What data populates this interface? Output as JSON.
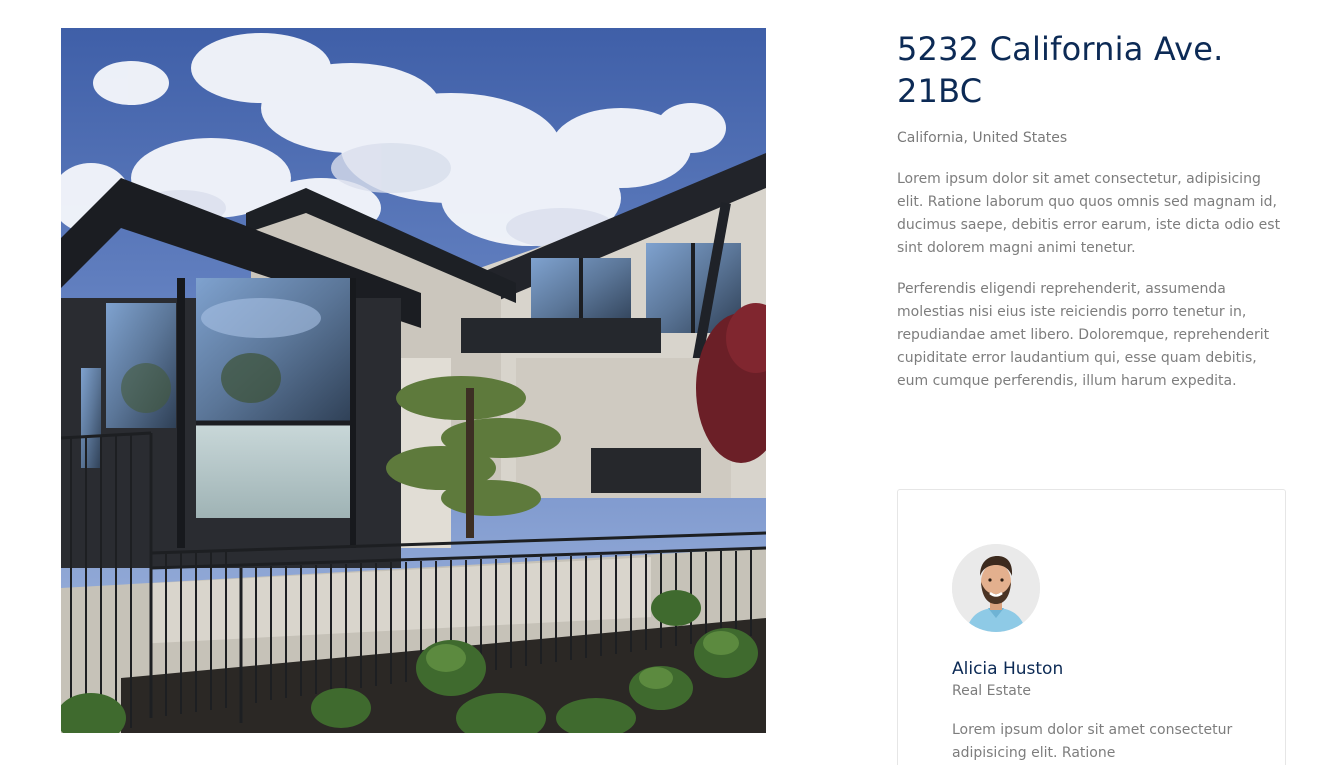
{
  "property": {
    "title": "5232 California Ave. 21BC",
    "location": "California, United States",
    "description": [
      "Lorem ipsum dolor sit amet consectetur, adipisicing elit. Ratione laborum quo quos omnis sed magnam id, ducimus saepe, debitis error earum, iste dicta odio est sint dolorem magni animi tenetur.",
      "Perferendis eligendi reprehenderit, assumenda molestias nisi eius iste reiciendis porro tenetur in, repudiandae amet libero. Doloremque, reprehenderit cupiditate error laudantium qui, esse quam debitis, eum cumque perferendis, illum harum expedita."
    ],
    "photo_icon": "modern-house-photo"
  },
  "agent": {
    "name": "Alicia Huston",
    "role": "Real Estate",
    "bio": "Lorem ipsum dolor sit amet consectetur adipisicing elit. Ratione",
    "avatar_icon": "agent-avatar-photo"
  },
  "colors": {
    "heading": "#0c2a55",
    "body_text": "#7d7d7d",
    "card_border": "#e6e6e6"
  }
}
